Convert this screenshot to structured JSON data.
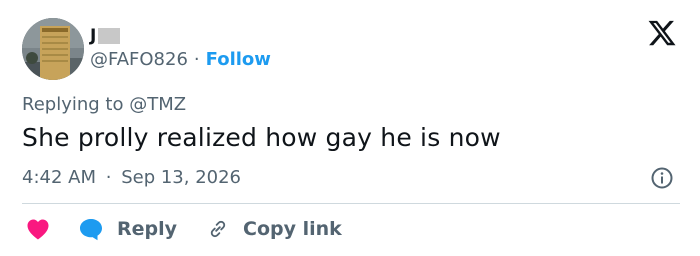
{
  "author": {
    "name": "J",
    "handle": "@FAFO826",
    "separator": "·",
    "follow_label": "Follow",
    "avatar_icon": "building-photo-avatar"
  },
  "reply_context": {
    "prefix": "Replying to",
    "mention": "@TMZ"
  },
  "tweet": {
    "text": "She prolly realized how gay he is now",
    "time": "4:42 AM",
    "separator": "·",
    "date": "Sep 13, 2026"
  },
  "actions": {
    "like_icon": "heart-icon",
    "reply_label": "Reply",
    "reply_icon": "speech-bubble-icon",
    "copy_label": "Copy link",
    "copy_icon": "link-icon"
  },
  "icons": {
    "brand": "x-logo-icon",
    "info": "info-icon"
  },
  "colors": {
    "accent": "#1d9bf0",
    "like": "#f91880",
    "text": "#0f1419",
    "muted": "#536471",
    "divider": "#cfd9de"
  }
}
